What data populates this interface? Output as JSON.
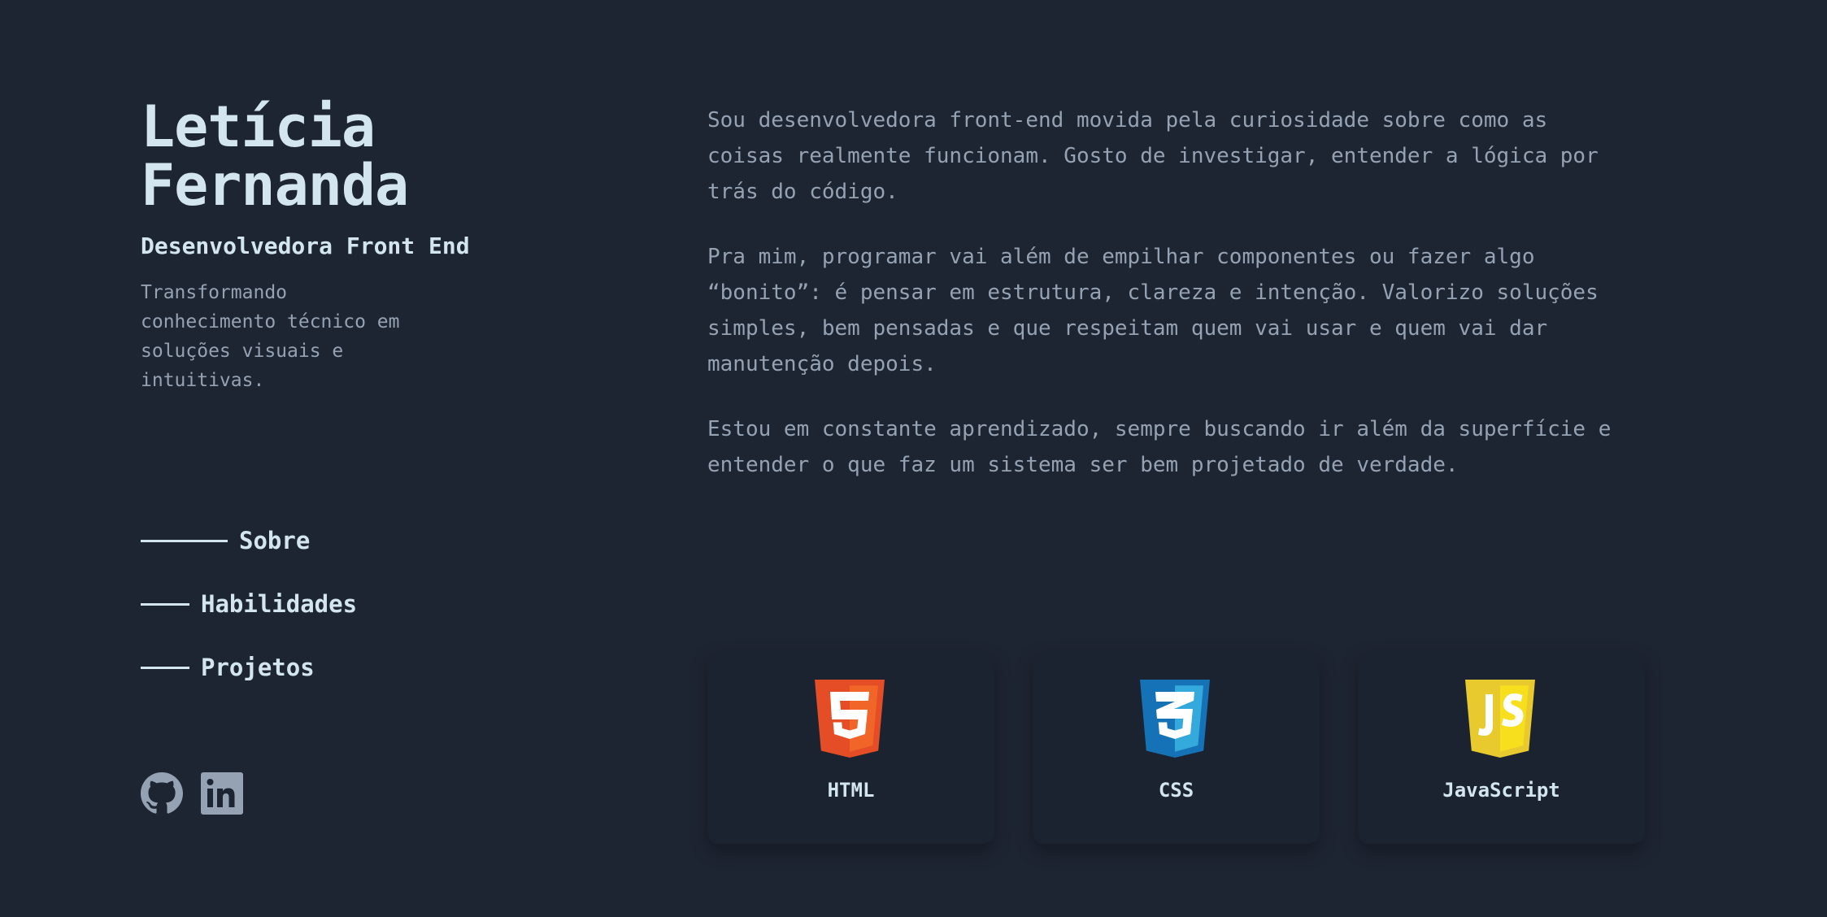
{
  "profile": {
    "name_line1": "Letícia",
    "name_line2": "Fernanda",
    "role": "Desenvolvedora Front End",
    "tagline": "Transformando conhecimento técnico em soluções visuais e intuitivas."
  },
  "nav": {
    "items": [
      {
        "label": "Sobre",
        "active": true
      },
      {
        "label": "Habilidades",
        "active": false
      },
      {
        "label": "Projetos",
        "active": false
      }
    ]
  },
  "socials": [
    {
      "icon": "github-icon"
    },
    {
      "icon": "linkedin-icon"
    }
  ],
  "about": {
    "paragraphs": [
      "Sou desenvolvedora front-end movida pela curiosidade sobre como as coisas realmente funcionam. Gosto de investigar, entender a lógica por trás do código.",
      "Pra mim, programar vai além de empilhar componentes ou fazer algo “bonito”: é pensar em estrutura, clareza e intenção. Valorizo soluções simples, bem pensadas e que respeitam quem vai usar e quem vai dar manutenção depois.",
      "Estou em constante aprendizado, sempre buscando ir além da superfície e entender o que faz um sistema ser bem projetado de verdade."
    ]
  },
  "skills": [
    {
      "label": "HTML",
      "icon": "html5-icon",
      "color": "#e44d26"
    },
    {
      "label": "CSS",
      "icon": "css3-icon",
      "color": "#1572b6"
    },
    {
      "label": "JavaScript",
      "icon": "javascript-icon",
      "color": "#f0db4f"
    }
  ],
  "colors": {
    "background": "#1e2532",
    "heading": "#d3e5ef",
    "body_text": "#95a2b3",
    "card": "#1b2230"
  }
}
